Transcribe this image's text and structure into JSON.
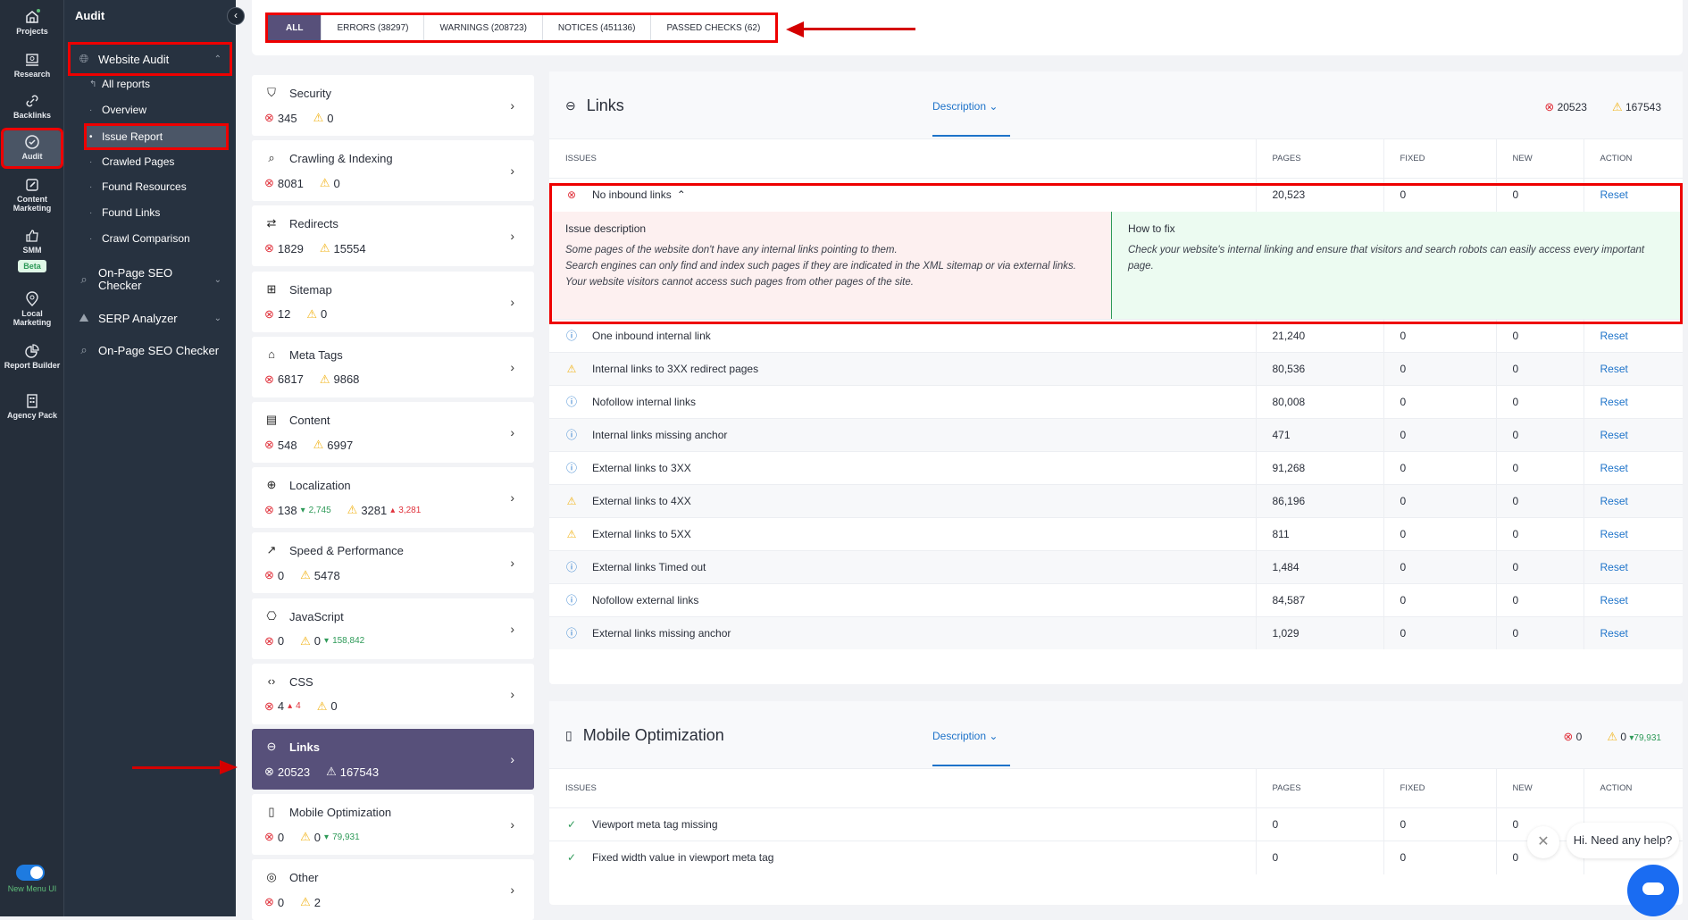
{
  "rail": {
    "items": [
      {
        "label": "Projects",
        "icon": "home-icon"
      },
      {
        "label": "Research",
        "icon": "research-icon"
      },
      {
        "label": "Backlinks",
        "icon": "link-icon"
      },
      {
        "label": "Audit",
        "icon": "check-circle-icon"
      },
      {
        "label": "Content Marketing",
        "icon": "edit-icon"
      },
      {
        "label": "SMM",
        "icon": "thumbs-up-icon",
        "badge": "Beta"
      },
      {
        "label": "Local Marketing",
        "icon": "location-pin-icon"
      },
      {
        "label": "Report Builder",
        "icon": "pie-chart-icon"
      },
      {
        "label": "Agency Pack",
        "icon": "building-icon"
      }
    ],
    "toggle_label": "New Menu UI"
  },
  "nav": {
    "title": "Audit",
    "website_audit": "Website Audit",
    "sub_items": [
      "All reports",
      "Overview",
      "Issue Report",
      "Crawled Pages",
      "Found Resources",
      "Found Links",
      "Crawl Comparison"
    ],
    "on_page_seo_checker_1": "On-Page SEO Checker",
    "serp_analyzer": "SERP Analyzer",
    "on_page_seo_checker_2": "On-Page SEO Checker"
  },
  "tabs": [
    {
      "label": "ALL"
    },
    {
      "label": "ERRORS (38297)"
    },
    {
      "label": "WARNINGS (208723)"
    },
    {
      "label": "NOTICES (451136)"
    },
    {
      "label": "PASSED CHECKS (62)"
    }
  ],
  "categories": [
    {
      "name": "Security",
      "icon": "shield-icon",
      "errors": "345",
      "warnings": "0"
    },
    {
      "name": "Crawling & Indexing",
      "icon": "search-icon",
      "errors": "8081",
      "warnings": "0"
    },
    {
      "name": "Redirects",
      "icon": "redirect-icon",
      "errors": "1829",
      "warnings": "15554"
    },
    {
      "name": "Sitemap",
      "icon": "grid-icon",
      "errors": "12",
      "warnings": "0"
    },
    {
      "name": "Meta Tags",
      "icon": "tag-icon",
      "errors": "6817",
      "warnings": "9868"
    },
    {
      "name": "Content",
      "icon": "document-icon",
      "errors": "548",
      "warnings": "6997"
    },
    {
      "name": "Localization",
      "icon": "globe-icon",
      "errors": "138",
      "errors_delta": "2,745",
      "warnings": "3281",
      "warnings_delta": "3,281"
    },
    {
      "name": "Speed & Performance",
      "icon": "trending-icon",
      "errors": "0",
      "warnings": "5478"
    },
    {
      "name": "JavaScript",
      "icon": "js-icon",
      "errors": "0",
      "warnings": "0",
      "warnings_delta": "158,842"
    },
    {
      "name": "CSS",
      "icon": "code-icon",
      "errors": "4",
      "errors_delta": "4",
      "warnings": "0"
    },
    {
      "name": "Links",
      "icon": "link-icon",
      "errors": "20523",
      "warnings": "167543"
    },
    {
      "name": "Mobile Optimization",
      "icon": "mobile-icon",
      "errors": "0",
      "warnings": "0",
      "warnings_delta": "79,931"
    },
    {
      "name": "Other",
      "icon": "target-icon",
      "errors": "0",
      "warnings": "2"
    }
  ],
  "links_panel": {
    "title": "Links",
    "description_label": "Description",
    "errors": "20523",
    "warnings": "167543",
    "columns": [
      "ISSUES",
      "PAGES",
      "FIXED",
      "NEW",
      "ACTION"
    ],
    "expanded": {
      "issue": "No inbound links",
      "type": "error",
      "pages": "20,523",
      "fixed": "0",
      "new": "0",
      "action": "Reset",
      "desc_title": "Issue description",
      "desc_lines": [
        "Some pages of the website don't have any internal links pointing to them.",
        "Search engines can only find and index such pages if they are indicated in the XML sitemap or via external links.",
        "Your website visitors cannot access such pages from other pages of the site."
      ],
      "fix_title": "How to fix",
      "fix_text": "Check your website's internal linking and ensure that visitors and search robots can easily access every important page."
    },
    "rows": [
      {
        "issue": "One inbound internal link",
        "type": "notice",
        "pages": "21,240",
        "fixed": "0",
        "new": "0",
        "action": "Reset"
      },
      {
        "issue": "Internal links to 3XX redirect pages",
        "type": "warning",
        "pages": "80,536",
        "fixed": "0",
        "new": "0",
        "action": "Reset"
      },
      {
        "issue": "Nofollow internal links",
        "type": "notice",
        "pages": "80,008",
        "fixed": "0",
        "new": "0",
        "action": "Reset"
      },
      {
        "issue": "Internal links missing anchor",
        "type": "notice",
        "pages": "471",
        "fixed": "0",
        "new": "0",
        "action": "Reset"
      },
      {
        "issue": "External links to 3XX",
        "type": "notice",
        "pages": "91,268",
        "fixed": "0",
        "new": "0",
        "action": "Reset"
      },
      {
        "issue": "External links to 4XX",
        "type": "warning",
        "pages": "86,196",
        "fixed": "0",
        "new": "0",
        "action": "Reset"
      },
      {
        "issue": "External links to 5XX",
        "type": "warning",
        "pages": "811",
        "fixed": "0",
        "new": "0",
        "action": "Reset"
      },
      {
        "issue": "External links Timed out",
        "type": "notice",
        "pages": "1,484",
        "fixed": "0",
        "new": "0",
        "action": "Reset"
      },
      {
        "issue": "Nofollow external links",
        "type": "notice",
        "pages": "84,587",
        "fixed": "0",
        "new": "0",
        "action": "Reset"
      },
      {
        "issue": "External links missing anchor",
        "type": "notice",
        "pages": "1,029",
        "fixed": "0",
        "new": "0",
        "action": "Reset"
      }
    ]
  },
  "mobile_panel": {
    "title": "Mobile Optimization",
    "description_label": "Description",
    "errors": "0",
    "warnings": "0",
    "warnings_delta": "79,931",
    "columns": [
      "ISSUES",
      "PAGES",
      "FIXED",
      "NEW",
      "ACTION"
    ],
    "rows": [
      {
        "issue": "Viewport meta tag missing",
        "type": "passed",
        "pages": "0",
        "fixed": "0",
        "new": "0"
      },
      {
        "issue": "Fixed width value in viewport meta tag",
        "type": "passed",
        "pages": "0",
        "fixed": "0",
        "new": "0"
      }
    ]
  },
  "chat": {
    "message": "Hi. Need any help?"
  },
  "colors": {
    "accent": "#57507a",
    "error": "#e0313b",
    "warning": "#f2b51d",
    "notice": "#1e73c9",
    "passed": "#2e9a58",
    "annotation": "#e00000"
  }
}
